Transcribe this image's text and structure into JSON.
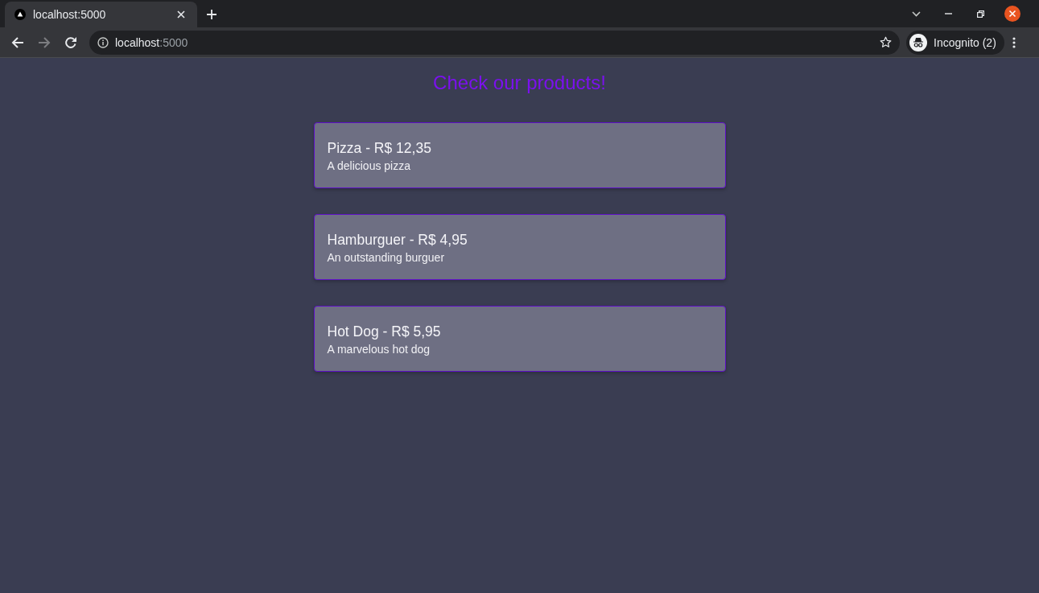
{
  "browser": {
    "tabs": [
      {
        "title": "localhost:5000",
        "selected": true
      }
    ],
    "nav_buttons": [
      {
        "kind": "back",
        "disabled": false
      },
      {
        "kind": "forward",
        "disabled": true
      },
      {
        "kind": "reload",
        "disabled": false
      }
    ],
    "address_bar": {
      "host": "localhost",
      "port": ":5000"
    },
    "profile": {
      "label": "Incognito (2)"
    }
  },
  "page": {
    "heading": "Check our products!",
    "products": [
      {
        "title": "Pizza - R$ 12,35",
        "description": "A delicious pizza"
      },
      {
        "title": "Hamburguer - R$ 4,95",
        "description": "An outstanding burguer"
      },
      {
        "title": "Hot Dog - R$ 5,95",
        "description": "A marvelous hot dog"
      }
    ]
  }
}
